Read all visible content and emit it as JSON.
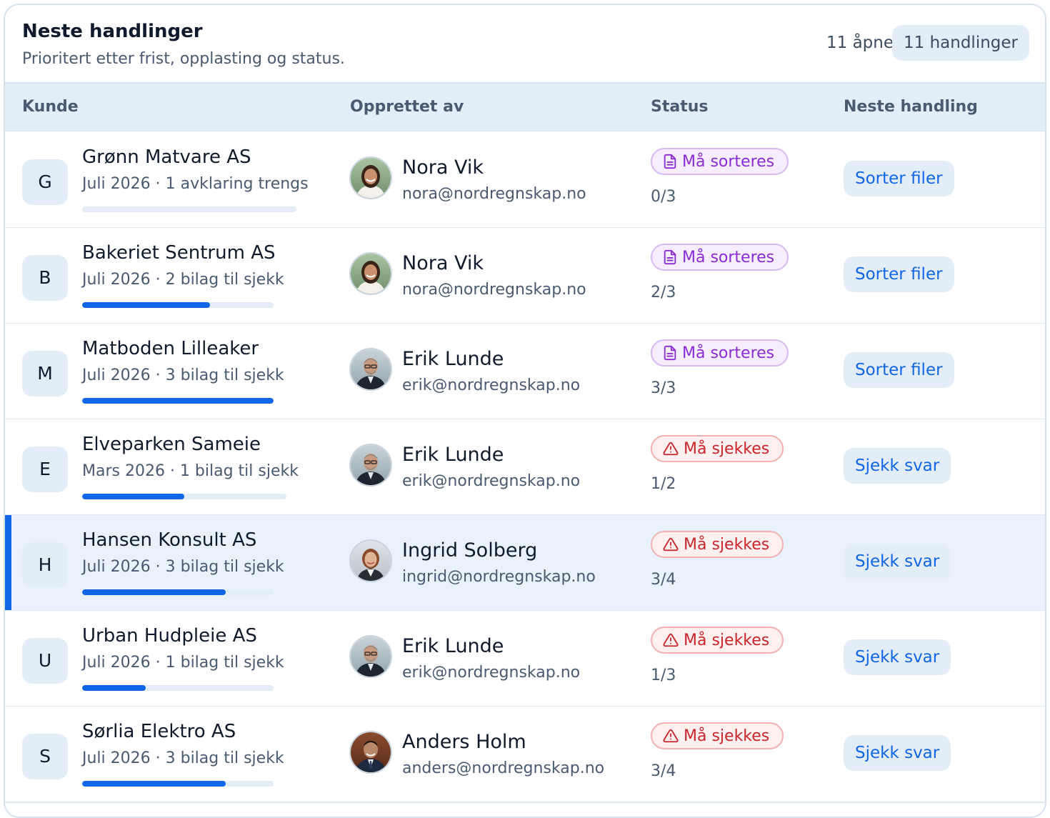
{
  "header": {
    "title": "Neste handlinger",
    "subtitle": "Prioritert etter frist, opplasting og status.",
    "open_count": "11 åpne",
    "actions_badge": "11 handlinger"
  },
  "columns": {
    "customer": "Kunde",
    "created_by": "Opprettet av",
    "status": "Status",
    "next_action": "Neste handling"
  },
  "rows": [
    {
      "letter": "G",
      "name": "Grønn Matvare AS",
      "meta": "Juli 2026 · 1 avklaring trengs",
      "progress": 0.0,
      "person": "Nora Vik",
      "email": "nora@nordregnskap.no",
      "status": "Må sorteres",
      "status_kind": "sort",
      "count": "0/3",
      "action": "Sorter filer",
      "selected": false
    },
    {
      "letter": "B",
      "name": "Bakeriet Sentrum AS",
      "meta": "Juli 2026 · 2 bilag til sjekk",
      "progress": 0.667,
      "person": "Nora Vik",
      "email": "nora@nordregnskap.no",
      "status": "Må sorteres",
      "status_kind": "sort",
      "count": "2/3",
      "action": "Sorter filer",
      "selected": false
    },
    {
      "letter": "M",
      "name": "Matboden Lilleaker",
      "meta": "Juli 2026 · 3 bilag til sjekk",
      "progress": 1.0,
      "person": "Erik Lunde",
      "email": "erik@nordregnskap.no",
      "status": "Må sorteres",
      "status_kind": "sort",
      "count": "3/3",
      "action": "Sorter filer",
      "selected": false
    },
    {
      "letter": "E",
      "name": "Elveparken Sameie",
      "meta": "Mars 2026 · 1 bilag til sjekk",
      "progress": 0.5,
      "person": "Erik Lunde",
      "email": "erik@nordregnskap.no",
      "status": "Må sjekkes",
      "status_kind": "check",
      "count": "1/2",
      "action": "Sjekk svar",
      "selected": false
    },
    {
      "letter": "H",
      "name": "Hansen Konsult AS",
      "meta": "Juli 2026 · 3 bilag til sjekk",
      "progress": 0.75,
      "person": "Ingrid Solberg",
      "email": "ingrid@nordregnskap.no",
      "status": "Må sjekkes",
      "status_kind": "check",
      "count": "3/4",
      "action": "Sjekk svar",
      "selected": true
    },
    {
      "letter": "U",
      "name": "Urban Hudpleie AS",
      "meta": "Juli 2026 · 1 bilag til sjekk",
      "progress": 0.333,
      "person": "Erik Lunde",
      "email": "erik@nordregnskap.no",
      "status": "Må sjekkes",
      "status_kind": "check",
      "count": "1/3",
      "action": "Sjekk svar",
      "selected": false
    },
    {
      "letter": "S",
      "name": "Sørlia Elektro AS",
      "meta": "Juli 2026 · 3 bilag til sjekk",
      "progress": 0.75,
      "person": "Anders Holm",
      "email": "anders@nordregnskap.no",
      "status": "Må sjekkes",
      "status_kind": "check",
      "count": "3/4",
      "action": "Sjekk svar",
      "selected": false
    }
  ],
  "colors": {
    "accent": "#1166e8",
    "sort_text": "#8a2bd6",
    "check_text": "#c9252b",
    "header_bg": "#e4eef9"
  },
  "icons": {
    "sort": "document-icon",
    "check": "warning-icon"
  }
}
